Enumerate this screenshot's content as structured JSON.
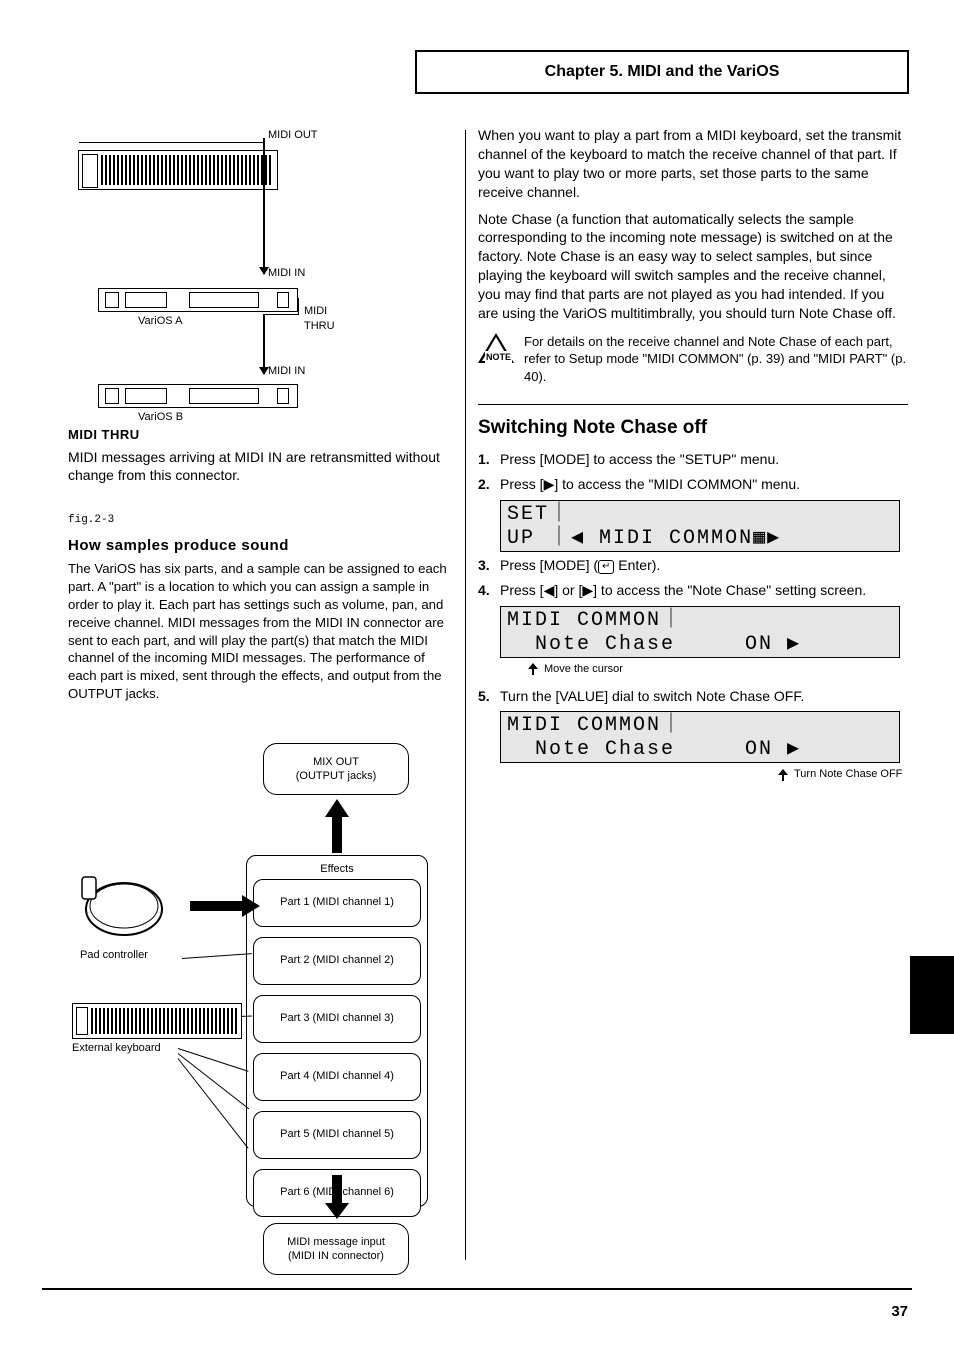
{
  "chapter_title": "Chapter 5. MIDI and the VariOS",
  "left": {
    "label_midi_out_1": "MIDI OUT",
    "label_midi_in_1": "MIDI IN",
    "device_varios_a": "VariOS A",
    "label_midi_thru": "MIDI THRU",
    "label_midi_in_2": "MIDI IN",
    "device_varios_b": "VariOS B",
    "thru_header": "MIDI THRU",
    "thru_body": "MIDI messages arriving at MIDI IN are retransmitted without change from this connector.",
    "fig_caption": "fig.2-3",
    "sample_header": "How samples produce sound",
    "sample_body": "The VariOS has six parts, and a sample can be assigned to each part. A \"part\" is a location to which you can assign a sample in order to play it. Each part has settings such as volume, pan, and receive channel. MIDI messages from the MIDI IN connector are sent to each part, and will play the part(s) that match the MIDI channel of the incoming MIDI messages. The performance of each part is mixed, sent through the effects, and output from the OUTPUT jacks.",
    "out_box": "MIX OUT\n(OUTPUT jacks)",
    "effects_label": "Effects",
    "parts": [
      "Part 1 (MIDI channel 1)",
      "Part 2 (MIDI channel 2)",
      "Part 3 (MIDI channel 3)",
      "Part 4 (MIDI channel 4)",
      "Part 5 (MIDI channel 5)",
      "Part 6 (MIDI channel 6)"
    ],
    "in_box": "MIDI message input\n(MIDI IN connector)",
    "pad_label": "Pad controller",
    "kb_label": "External keyboard"
  },
  "right": {
    "intro": "When you want to play a part from a MIDI keyboard, set the transmit channel of the keyboard to match the receive channel of that part. If you want to play two or more parts, set those parts to the same receive channel.",
    "intro2": "Note Chase (a function that automatically selects the sample corresponding to the incoming note message) is switched on at the factory. Note Chase is an easy way to select samples, but since playing the keyboard will switch samples and the receive channel, you may find that parts are not played as you had intended. If you are using the VariOS multitimbrally, you should turn Note Chase off.",
    "note_body": "For details on the receive channel and Note Chase of each part, refer to Setup mode \"MIDI COMMON\" (p. 39) and \"MIDI PART\" (p. 40).",
    "section_title": "Switching Note Chase off",
    "step1": "Press [MODE] to access the \"SETUP\" menu.",
    "step2_a": "Press [",
    "step2_b": "] to access the \"MIDI COMMON\" menu.",
    "lcd1_l1": "SET｜",
    "lcd1_l2": "UP ｜◀ MIDI COMMON▦▶",
    "step3_a": "Press [MODE] (",
    "step3_b": " Enter).",
    "step4_a": "Press [",
    "step4_b": "] or [",
    "step4_c": "] to access the \"Note Chase\" setting screen.",
    "lcd2_l1": "MIDI COMMON｜",
    "lcd2_l2": "  Note Chase     ON ▶",
    "sub2": "Move the cursor",
    "step5": "Turn the [VALUE] dial to switch Note Chase OFF.",
    "lcd3_l1": "MIDI COMMON｜",
    "lcd3_l2": "  Note Chase     ON ▶",
    "sub3": "Turn Note Chase OFF"
  },
  "page_number": "37"
}
